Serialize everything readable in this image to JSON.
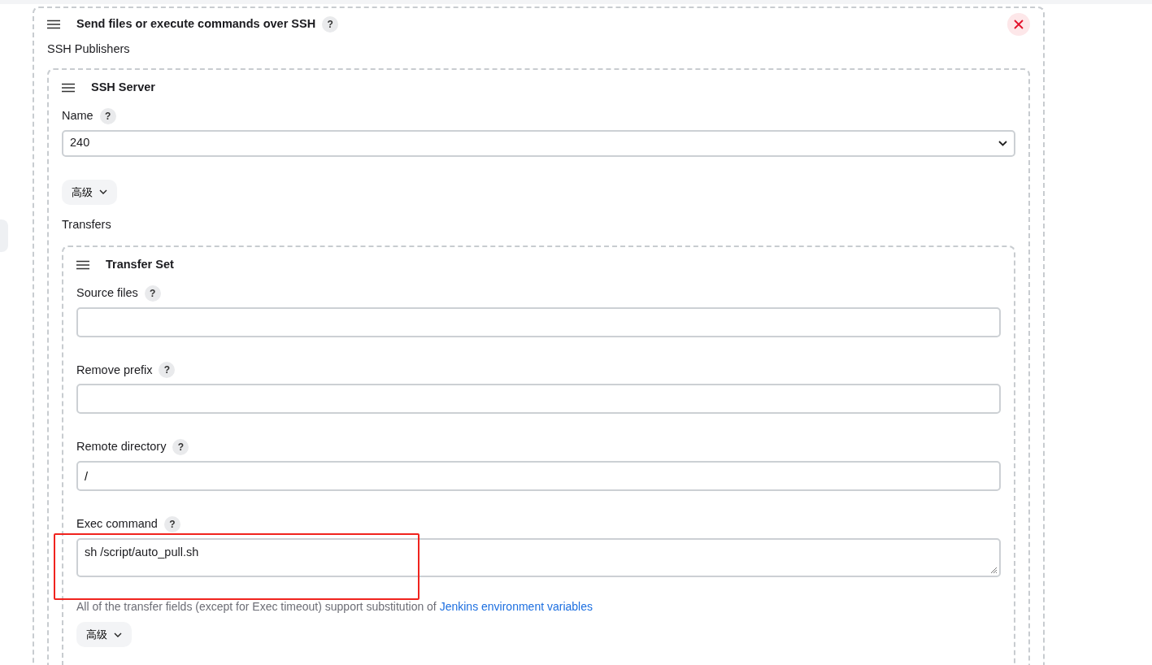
{
  "section": {
    "title": "Send files or execute commands over SSH",
    "subtitle": "SSH Publishers"
  },
  "server": {
    "title": "SSH Server",
    "name_label": "Name",
    "name_value": "240",
    "advanced": "高级",
    "transfers_label": "Transfers"
  },
  "transfer_set": {
    "title": "Transfer Set",
    "fields": [
      {
        "kind": "input",
        "label": "Source files"
      },
      {
        "kind": "input",
        "label": "Remove prefix"
      },
      {
        "kind": "input",
        "label": "Remote directory",
        "value": "/"
      },
      {
        "kind": "textarea",
        "label": "Exec command",
        "value": "sh /script/auto_pull.sh",
        "highlighted": true
      }
    ],
    "note": "All of the transfer fields (except for Exec timeout) support substitution of ",
    "note_link": "Jenkins environment variables",
    "advanced": "高级"
  },
  "help_mark": "?"
}
